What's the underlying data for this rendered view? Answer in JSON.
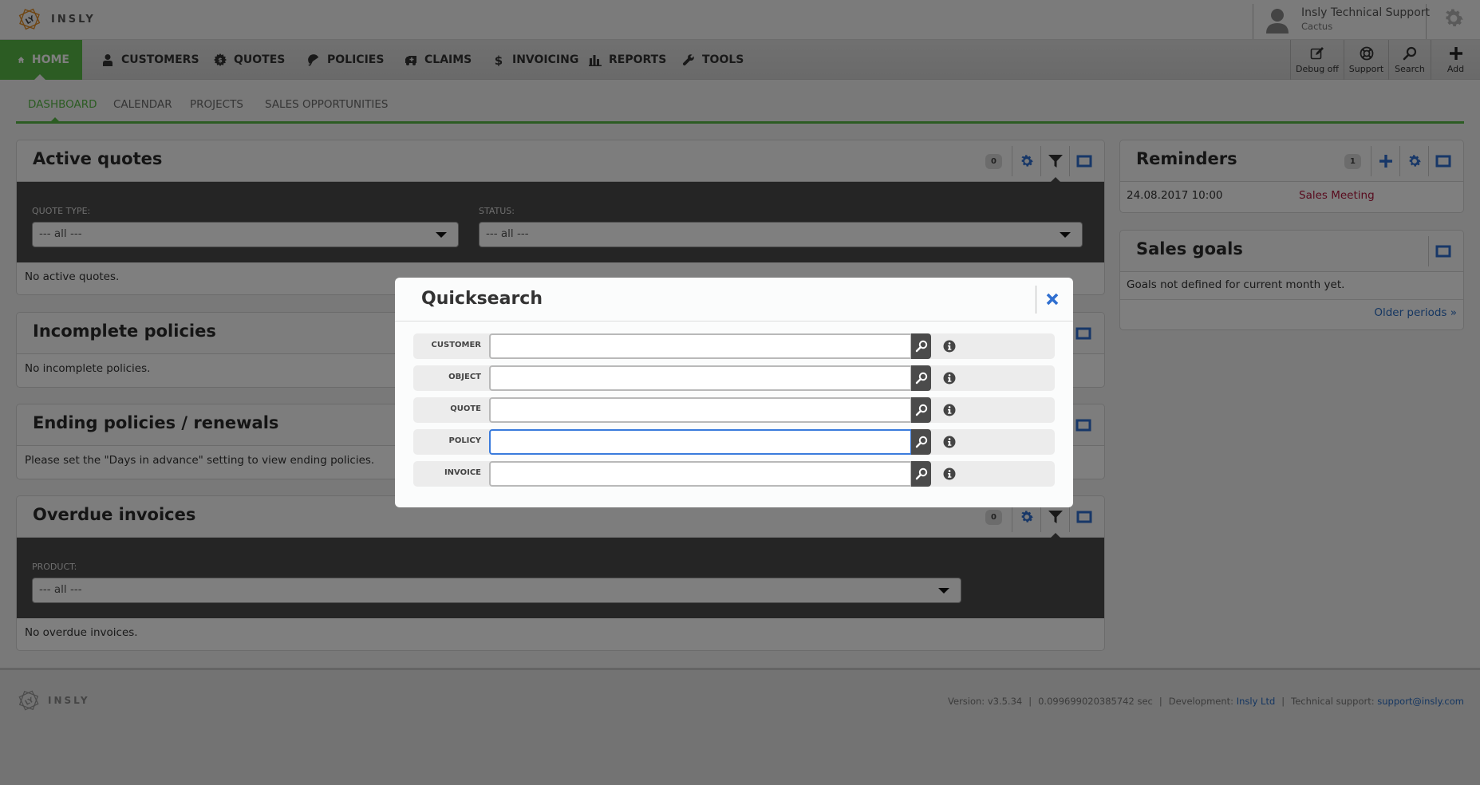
{
  "brand": {
    "name": "INSLY"
  },
  "user": {
    "name": "Insly Technical Support",
    "organization": "Cactus"
  },
  "main_nav": [
    {
      "label": "HOME",
      "icon": "home-icon",
      "active": true
    },
    {
      "label": "CUSTOMERS",
      "icon": "user-icon",
      "active": false
    },
    {
      "label": "QUOTES",
      "icon": "quote-badge-icon",
      "active": false
    },
    {
      "label": "POLICIES",
      "icon": "umbrella-icon",
      "active": false
    },
    {
      "label": "CLAIMS",
      "icon": "ambulance-icon",
      "active": false
    },
    {
      "label": "INVOICING",
      "icon": "dollar-icon",
      "active": false
    },
    {
      "label": "REPORTS",
      "icon": "bar-chart-icon",
      "active": false
    },
    {
      "label": "TOOLS",
      "icon": "wrench-icon",
      "active": false
    }
  ],
  "toolbar": [
    {
      "label": "Debug off",
      "icon": "edit-icon"
    },
    {
      "label": "Support",
      "icon": "lifebuoy-icon"
    },
    {
      "label": "Search",
      "icon": "search-icon"
    },
    {
      "label": "Add",
      "icon": "plus-icon"
    }
  ],
  "sub_nav": [
    {
      "label": "DASHBOARD",
      "active": true
    },
    {
      "label": "CALENDAR",
      "active": false
    },
    {
      "label": "PROJECTS",
      "active": false
    },
    {
      "label": "SALES OPPORTUNITIES",
      "active": false
    }
  ],
  "panels": {
    "active_quotes": {
      "title": "Active quotes",
      "count": "0",
      "filters": {
        "quote_type": {
          "label": "QUOTE TYPE:",
          "value": "--- all ---"
        },
        "status": {
          "label": "STATUS:",
          "value": "--- all ---"
        }
      },
      "empty_text": "No active quotes."
    },
    "incomplete_policies": {
      "title": "Incomplete policies",
      "empty_text": "No incomplete policies."
    },
    "ending_policies": {
      "title": "Ending policies / renewals",
      "empty_text": "Please set the \"Days in advance\" setting to view ending policies."
    },
    "overdue_invoices": {
      "title": "Overdue invoices",
      "count": "0",
      "filters": {
        "product": {
          "label": "PRODUCT:",
          "value": "--- all ---"
        }
      },
      "empty_text": "No overdue invoices."
    },
    "reminders": {
      "title": "Reminders",
      "count": "1",
      "items": [
        {
          "date": "24.08.2017 10:00",
          "title": "Sales Meeting"
        }
      ]
    },
    "sales_goals": {
      "title": "Sales goals",
      "empty_text": "Goals not defined for current month yet.",
      "older_link": "Older periods »"
    }
  },
  "quicksearch": {
    "title": "Quicksearch",
    "fields": [
      {
        "label": "CUSTOMER",
        "value": "",
        "focused": false
      },
      {
        "label": "OBJECT",
        "value": "",
        "focused": false
      },
      {
        "label": "QUOTE",
        "value": "",
        "focused": false
      },
      {
        "label": "POLICY",
        "value": "",
        "focused": true
      },
      {
        "label": "INVOICE",
        "value": "",
        "focused": false
      }
    ]
  },
  "footer": {
    "version": "Version: v3.5.34",
    "time": "0.099699020385742 sec",
    "development_label": "Development:",
    "development_link": "Insly Ltd",
    "support_label": "Technical support:",
    "support_link": "support@insly.com"
  },
  "colors": {
    "brand_green": "#59b947",
    "link_blue": "#2a6cc2",
    "icon_blue": "#2f6fd0",
    "reminder_red": "#b0173c",
    "logo_orange": "#e08a22"
  }
}
